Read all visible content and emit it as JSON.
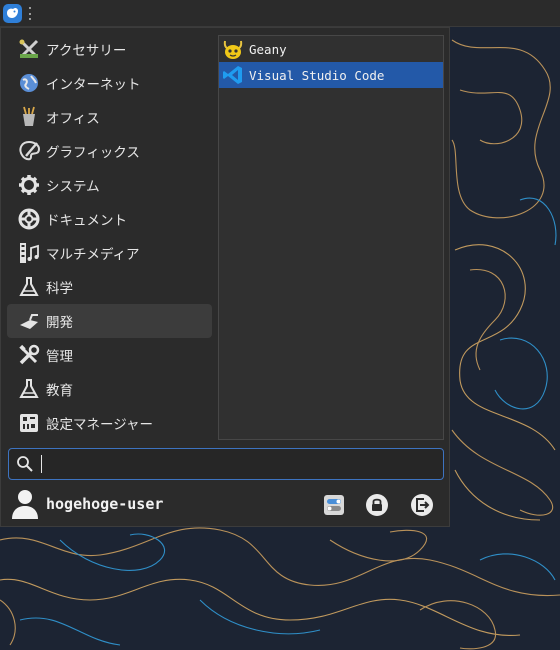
{
  "panel": {
    "menu_button_icon": "whisker-menu-icon",
    "handle_icon": "panel-handle-icon"
  },
  "menu": {
    "categories": [
      {
        "label": "アクセサリー",
        "icon": "accessories-icon"
      },
      {
        "label": "インターネット",
        "icon": "internet-globe-icon"
      },
      {
        "label": "オフィス",
        "icon": "office-icon"
      },
      {
        "label": "グラフィックス",
        "icon": "graphics-icon"
      },
      {
        "label": "システム",
        "icon": "gear-icon"
      },
      {
        "label": "ドキュメント",
        "icon": "lifebuoy-icon"
      },
      {
        "label": "マルチメディア",
        "icon": "multimedia-icon"
      },
      {
        "label": "科学",
        "icon": "flask-icon"
      },
      {
        "label": "開発",
        "icon": "trowel-icon",
        "active": true
      },
      {
        "label": "管理",
        "icon": "tools-icon"
      },
      {
        "label": "教育",
        "icon": "flask-icon"
      },
      {
        "label": "設定マネージャー",
        "icon": "settings-manager-icon"
      }
    ],
    "apps": [
      {
        "label": "Geany",
        "icon": "geany-icon"
      },
      {
        "label": "Visual Studio Code",
        "icon": "vscode-icon",
        "selected": true
      }
    ],
    "search": {
      "placeholder": "",
      "value": ""
    },
    "user": {
      "name": "hogehoge-user"
    },
    "actions": [
      {
        "name": "settings",
        "icon": "toggle-settings-icon"
      },
      {
        "name": "lock",
        "icon": "lock-icon"
      },
      {
        "name": "logout",
        "icon": "logout-icon"
      }
    ]
  },
  "colors": {
    "menu_bg": "#2b2b2b",
    "selection": "#2359a8",
    "search_border": "#3d73c0",
    "wallpaper": "#1c2433"
  }
}
